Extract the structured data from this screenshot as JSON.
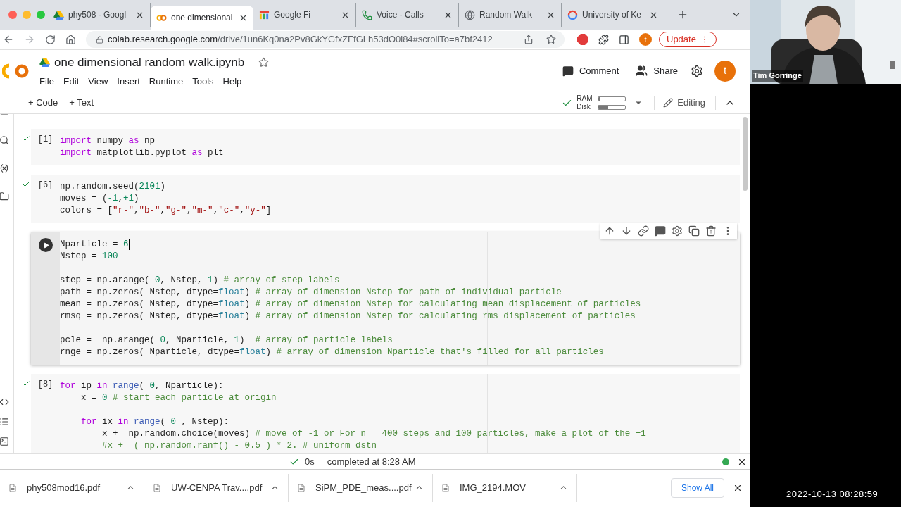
{
  "browser": {
    "tabs": [
      {
        "title": "phy508 - Googl",
        "selected": false
      },
      {
        "title": "one dimensional",
        "selected": true
      },
      {
        "title": "Google Fi",
        "selected": false
      },
      {
        "title": "Voice - Calls",
        "selected": false
      },
      {
        "title": "Random Walk",
        "selected": false
      },
      {
        "title": "University of Ke",
        "selected": false
      }
    ],
    "url_host": "colab.research.google.com",
    "url_path": "/drive/1un6Kq0na2Pv8GkYGfxZFfGLh53dO0i84#scrollTo=a7bf2412",
    "profile": "t",
    "update_button": "Update"
  },
  "notebook": {
    "title": "one dimensional random walk.ipynb",
    "menu": [
      "File",
      "Edit",
      "View",
      "Insert",
      "Runtime",
      "Tools",
      "Help"
    ],
    "comment_button": "Comment",
    "share_button": "Share",
    "avatar": "t",
    "toolbar": {
      "add_code": "+ Code",
      "add_text": "+ Text",
      "ram_label": "RAM",
      "disk_label": "Disk",
      "ram": {
        "level": 0.08
      },
      "disk": {
        "level": 0.35
      },
      "mode": "Editing"
    },
    "cells": [
      {
        "count": "[1]",
        "active": false,
        "ruler": false,
        "lines": [
          {
            "tokens": [
              {
                "kind": "kw",
                "text": "import"
              },
              {
                "kind": "p",
                "text": " numpy "
              },
              {
                "kind": "kw",
                "text": "as"
              },
              {
                "kind": "p",
                "text": " np"
              }
            ]
          },
          {
            "tokens": [
              {
                "kind": "kw",
                "text": "import"
              },
              {
                "kind": "p",
                "text": " matplotlib.pyplot "
              },
              {
                "kind": "kw",
                "text": "as"
              },
              {
                "kind": "p",
                "text": " plt"
              }
            ]
          }
        ]
      },
      {
        "count": "[6]",
        "active": false,
        "ruler": false,
        "lines": [
          {
            "tokens": [
              {
                "kind": "p",
                "text": "np.random.seed("
              },
              {
                "kind": "num",
                "text": "2101"
              },
              {
                "kind": "p",
                "text": ")"
              }
            ]
          },
          {
            "tokens": [
              {
                "kind": "p",
                "text": "moves = ("
              },
              {
                "kind": "num",
                "text": "-1"
              },
              {
                "kind": "p",
                "text": ","
              },
              {
                "kind": "num",
                "text": "+1"
              },
              {
                "kind": "p",
                "text": ")"
              }
            ]
          },
          {
            "tokens": [
              {
                "kind": "p",
                "text": "colors = ["
              },
              {
                "kind": "str",
                "text": "\"r-\""
              },
              {
                "kind": "p",
                "text": ","
              },
              {
                "kind": "str",
                "text": "\"b-\""
              },
              {
                "kind": "p",
                "text": ","
              },
              {
                "kind": "str",
                "text": "\"g-\""
              },
              {
                "kind": "p",
                "text": ","
              },
              {
                "kind": "str",
                "text": "\"m-\""
              },
              {
                "kind": "p",
                "text": ","
              },
              {
                "kind": "str",
                "text": "\"c-\""
              },
              {
                "kind": "p",
                "text": ","
              },
              {
                "kind": "str",
                "text": "\"y-\""
              },
              {
                "kind": "p",
                "text": "]"
              }
            ]
          }
        ]
      },
      {
        "active": true,
        "ruler": true,
        "lines": [
          {
            "cursor": true,
            "tokens": [
              {
                "kind": "p",
                "text": "Nparticle = "
              },
              {
                "kind": "num",
                "text": "6"
              }
            ]
          },
          {
            "tokens": [
              {
                "kind": "p",
                "text": "Nstep = "
              },
              {
                "kind": "num",
                "text": "100"
              }
            ]
          },
          {
            "blank_before": true,
            "tokens": [
              {
                "kind": "p",
                "text": "step = np.arange( "
              },
              {
                "kind": "num",
                "text": "0"
              },
              {
                "kind": "p",
                "text": ", Nstep, "
              },
              {
                "kind": "num",
                "text": "1"
              },
              {
                "kind": "p",
                "text": ") "
              },
              {
                "kind": "com",
                "text": "# array of step labels"
              }
            ]
          },
          {
            "tokens": [
              {
                "kind": "p",
                "text": "path = np.zeros( Nstep, dtype="
              },
              {
                "kind": "type",
                "text": "float"
              },
              {
                "kind": "p",
                "text": ") "
              },
              {
                "kind": "com",
                "text": "# array of dimension Nstep for path of individual particle"
              }
            ]
          },
          {
            "tokens": [
              {
                "kind": "p",
                "text": "mean = np.zeros( Nstep, dtype="
              },
              {
                "kind": "type",
                "text": "float"
              },
              {
                "kind": "p",
                "text": ") "
              },
              {
                "kind": "com",
                "text": "# array of dimension Nstep for calculating mean displacement of particles"
              }
            ]
          },
          {
            "tokens": [
              {
                "kind": "p",
                "text": "rmsq = np.zeros( Nstep, dtype="
              },
              {
                "kind": "type",
                "text": "float"
              },
              {
                "kind": "p",
                "text": ") "
              },
              {
                "kind": "com",
                "text": "# array of dimension Nstep for calculating rms displacement of particles"
              }
            ]
          },
          {
            "blank_before": true,
            "tokens": [
              {
                "kind": "p",
                "text": "pcle =  np.arange( "
              },
              {
                "kind": "num",
                "text": "0"
              },
              {
                "kind": "p",
                "text": ", Nparticle, "
              },
              {
                "kind": "num",
                "text": "1"
              },
              {
                "kind": "p",
                "text": ")  "
              },
              {
                "kind": "com",
                "text": "# array of particle labels"
              }
            ]
          },
          {
            "tokens": [
              {
                "kind": "p",
                "text": "rnge = np.zeros( Nparticle, dtype="
              },
              {
                "kind": "type",
                "text": "float"
              },
              {
                "kind": "p",
                "text": ") "
              },
              {
                "kind": "com",
                "text": "# array of dimension Nparticle that's filled for all particles"
              }
            ]
          }
        ]
      },
      {
        "count": "[8]",
        "active": false,
        "ruler": true,
        "lines": [
          {
            "tokens": [
              {
                "kind": "kw",
                "text": "for"
              },
              {
                "kind": "p",
                "text": " ip "
              },
              {
                "kind": "kw",
                "text": "in "
              },
              {
                "kind": "fn",
                "text": "range"
              },
              {
                "kind": "p",
                "text": "( "
              },
              {
                "kind": "num",
                "text": "0"
              },
              {
                "kind": "p",
                "text": ", Nparticle):"
              }
            ]
          },
          {
            "tokens": [
              {
                "kind": "p",
                "text": "    x = "
              },
              {
                "kind": "num",
                "text": "0"
              },
              {
                "kind": "com",
                "text": " # start each particle at origin"
              }
            ]
          },
          {
            "blank_before": true,
            "tokens": [
              {
                "kind": "kw",
                "text": "    for"
              },
              {
                "kind": "p",
                "text": " ix "
              },
              {
                "kind": "kw",
                "text": "in "
              },
              {
                "kind": "fn",
                "text": "range"
              },
              {
                "kind": "p",
                "text": "( "
              },
              {
                "kind": "num",
                "text": "0"
              },
              {
                "kind": "p",
                "text": " , Nstep):"
              }
            ]
          },
          {
            "tokens": [
              {
                "kind": "p",
                "text": "        x += np.random.choice(moves) "
              },
              {
                "kind": "com",
                "text": "# move of -1 or For n = 400 steps and 100 particles, make a plot of the +1"
              }
            ]
          },
          {
            "tokens": [
              {
                "kind": "com",
                "text": "        #x += ( np.random.ranf() - 0.5 ) * 2. # uniform dstn"
              }
            ]
          }
        ]
      }
    ],
    "status": {
      "time": "0s",
      "message": "completed at 8:28 AM",
      "connected": true
    }
  },
  "downloads": {
    "items": [
      "phy508mod16.pdf",
      "UW-CENPA Trav....pdf",
      "SiPM_PDE_meas....pdf",
      "IMG_2194.MOV"
    ],
    "show_all": "Show All"
  },
  "video": {
    "name": "Tim Gorringe",
    "timestamp": "2022-10-13 08:28:59"
  }
}
